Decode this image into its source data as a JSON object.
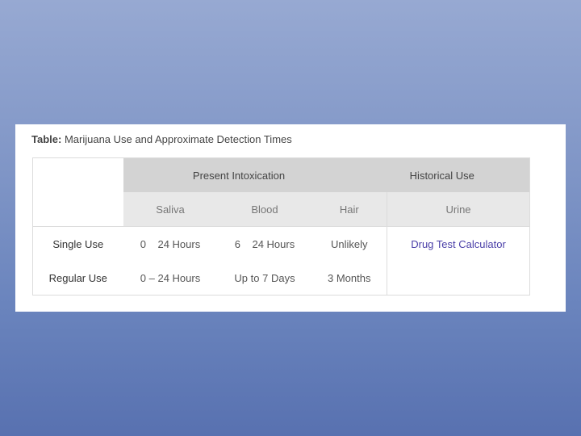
{
  "caption": {
    "prefix": "Table:",
    "title": "Marijuana Use and Approximate Detection Times"
  },
  "table": {
    "groups": [
      "Present Intoxication",
      "Historical Use"
    ],
    "columns": [
      "Saliva",
      "Blood",
      "Hair",
      "Urine"
    ],
    "rows": [
      {
        "label": "Single Use",
        "saliva": "0    24 Hours",
        "blood": "6    24 Hours",
        "hair": "Unlikely",
        "urine": "Drug Test Calculator"
      },
      {
        "label": "Regular Use",
        "saliva": "0 – 24 Hours",
        "blood": "Up to 7 Days",
        "hair": "3 Months",
        "urine": ""
      }
    ]
  },
  "colors": {
    "background_top": "#97a9d2",
    "background_bottom": "#5871b0",
    "group_header": "#d3d3d3",
    "sub_header": "#e8e8e8",
    "link": "#4a3fa8"
  }
}
